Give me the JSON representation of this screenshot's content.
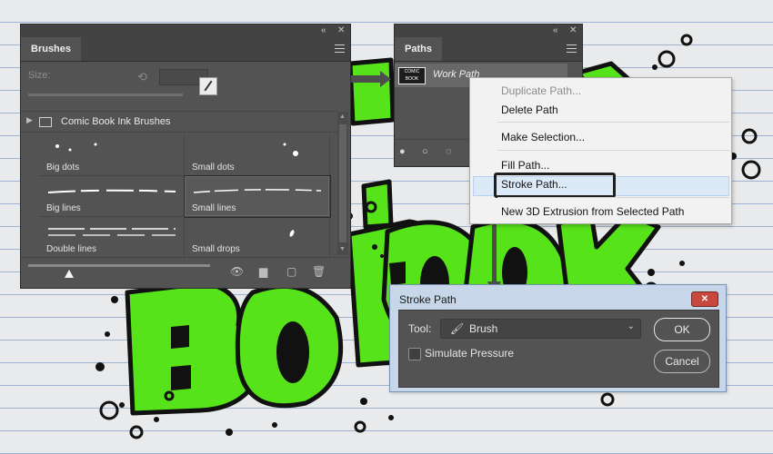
{
  "brushes_panel": {
    "tab_label": "Brushes",
    "size_label": "Size:",
    "group_label": "Comic Book Ink Brushes",
    "items": [
      {
        "label": "Big dots",
        "selected": false
      },
      {
        "label": "Small dots",
        "selected": false
      },
      {
        "label": "Big lines",
        "selected": false
      },
      {
        "label": "Small lines",
        "selected": true
      },
      {
        "label": "Double lines",
        "selected": false
      },
      {
        "label": "Small drops",
        "selected": false
      }
    ]
  },
  "paths_panel": {
    "tab_label": "Paths",
    "work_path_label": "Work Path",
    "thumb_text": "COMIC BOOK"
  },
  "context_menu": {
    "items": [
      {
        "label": "Duplicate Path...",
        "enabled": false
      },
      {
        "label": "Delete Path",
        "enabled": true
      },
      {
        "label": "Make Selection...",
        "enabled": true
      },
      {
        "label": "Fill Path...",
        "enabled": true
      },
      {
        "label": "Stroke Path...",
        "enabled": true,
        "highlighted": true
      },
      {
        "label": "New 3D Extrusion from Selected Path",
        "enabled": true
      }
    ]
  },
  "stroke_dialog": {
    "title": "Stroke Path",
    "tool_label": "Tool:",
    "tool_value": "Brush",
    "simulate_pressure_label": "Simulate Pressure",
    "simulate_pressure_checked": false,
    "ok_label": "OK",
    "cancel_label": "Cancel"
  },
  "colors": {
    "ink_green": "#57e31a",
    "panel_bg": "#535353",
    "menu_highlight": "#dceaf8"
  }
}
